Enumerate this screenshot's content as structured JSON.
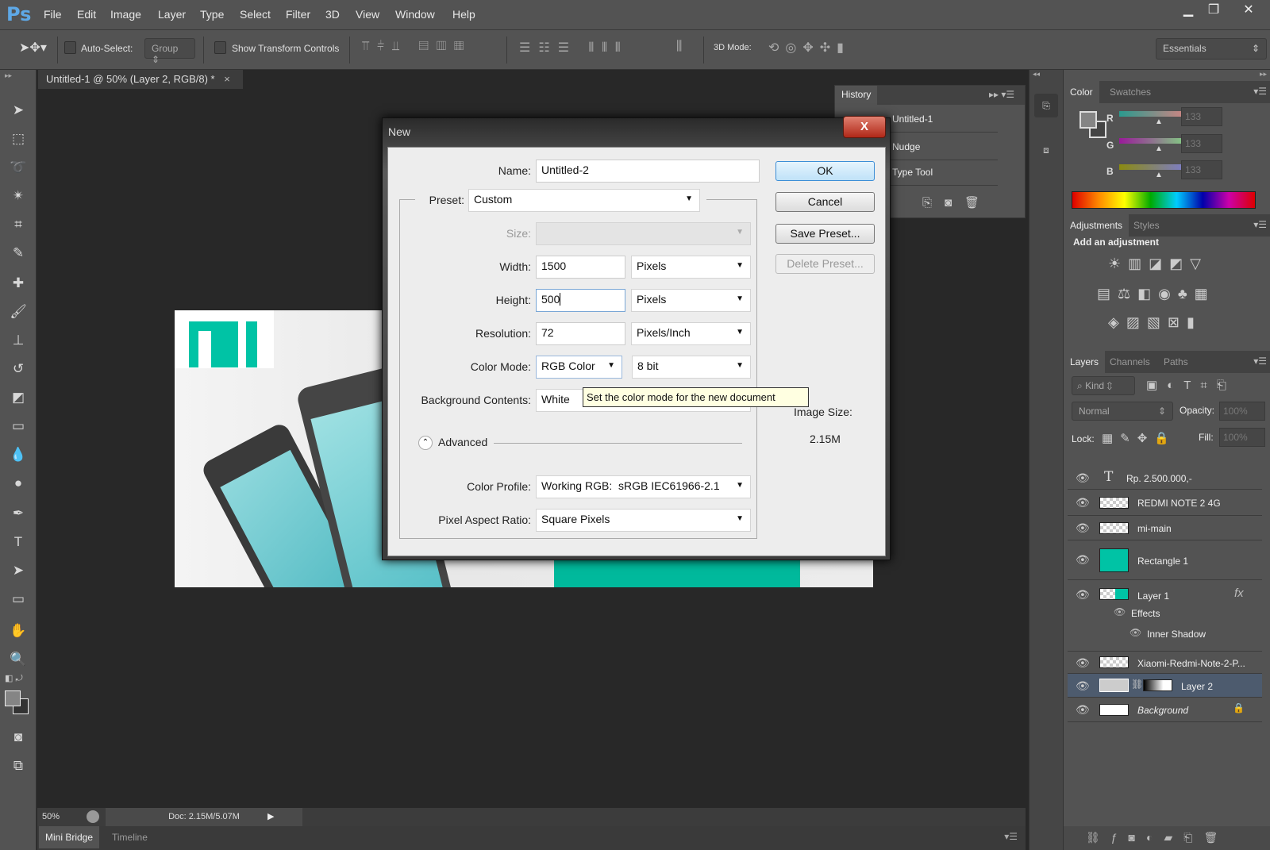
{
  "app": {
    "logo": "Ps"
  },
  "menu": [
    "File",
    "Edit",
    "Image",
    "Layer",
    "Type",
    "Select",
    "Filter",
    "3D",
    "View",
    "Window",
    "Help"
  ],
  "window_controls": {
    "minimize": "▁",
    "restore": "❐",
    "close": "✕"
  },
  "options_bar": {
    "auto_select_label": "Auto-Select:",
    "auto_select_value": "Group",
    "show_transform_label": "Show Transform Controls",
    "mode_3d_label": "3D Mode:",
    "workspace": "Essentials"
  },
  "document_tab": {
    "title": "Untitled-1 @ 50% (Layer 2, RGB/8) *",
    "close": "×"
  },
  "status_bar": {
    "zoom": "50%",
    "doc": "Doc: 2.15M/5.07M"
  },
  "bottom_tabs": [
    "Mini Bridge",
    "Timeline"
  ],
  "history": {
    "title": "History",
    "items": [
      "Untitled-1",
      "Nudge",
      "Type Tool"
    ]
  },
  "color_panel": {
    "tabs": [
      "Color",
      "Swatches"
    ],
    "channels": [
      {
        "label": "R",
        "value": "133"
      },
      {
        "label": "G",
        "value": "133"
      },
      {
        "label": "B",
        "value": "133"
      }
    ]
  },
  "adjustments_panel": {
    "tabs": [
      "Adjustments",
      "Styles"
    ],
    "heading": "Add an adjustment"
  },
  "layers_panel": {
    "tabs": [
      "Layers",
      "Channels",
      "Paths"
    ],
    "filter": "Kind",
    "blend_mode": "Normal",
    "opacity_label": "Opacity:",
    "opacity": "100%",
    "lock_label": "Lock:",
    "fill_label": "Fill:",
    "fill": "100%",
    "layers": [
      {
        "name": "Rp. 2.500.000,-",
        "type": "text"
      },
      {
        "name": "REDMI NOTE 2 4G"
      },
      {
        "name": "mi-main"
      },
      {
        "name": "Rectangle 1"
      },
      {
        "name": "Layer 1",
        "fx": "fx",
        "effects_label": "Effects",
        "effect": "Inner Shadow"
      },
      {
        "name": "Xiaomi-Redmi-Note-2-P..."
      },
      {
        "name": "Layer 2",
        "selected": true
      },
      {
        "name": "Background",
        "locked": true
      }
    ]
  },
  "dialog": {
    "title": "New",
    "close": "X",
    "name_label": "Name:",
    "name_value": "Untitled-2",
    "preset_label": "Preset:",
    "preset_value": "Custom",
    "size_label": "Size:",
    "width_label": "Width:",
    "width_value": "1500",
    "width_unit": "Pixels",
    "height_label": "Height:",
    "height_value": "500",
    "height_unit": "Pixels",
    "resolution_label": "Resolution:",
    "resolution_value": "72",
    "resolution_unit": "Pixels/Inch",
    "color_mode_label": "Color Mode:",
    "color_mode_value": "RGB Color",
    "bit_depth": "8 bit",
    "background_label": "Background Contents:",
    "background_value": "White",
    "tooltip": "Set the color mode for the new document",
    "advanced_label": "Advanced",
    "color_profile_label": "Color Profile:",
    "color_profile_value": "Working RGB:  sRGB IEC61966-2.1",
    "pixel_aspect_label": "Pixel Aspect Ratio:",
    "pixel_aspect_value": "Square Pixels",
    "buttons": {
      "ok": "OK",
      "cancel": "Cancel",
      "save_preset": "Save Preset...",
      "delete_preset": "Delete Preset..."
    },
    "image_size_label": "Image Size:",
    "image_size_value": "2.15M"
  },
  "colors": {
    "accent_teal": "#00c3a5",
    "ui_bg": "#535353",
    "canvas_bg": "#282828",
    "selected_layer": "#4d5b6e"
  }
}
